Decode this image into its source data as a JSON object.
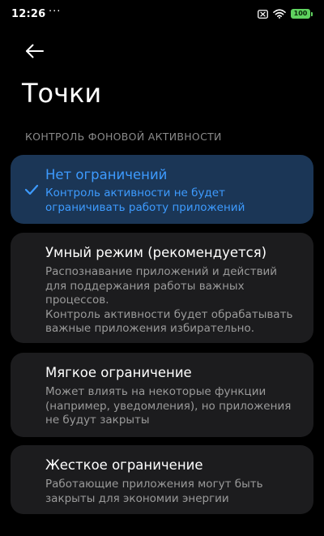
{
  "status_bar": {
    "time": "12:26",
    "more": "···",
    "battery": "100",
    "icons": [
      "no-sim-icon",
      "wifi-icon",
      "battery-icon"
    ],
    "battery_color": "#5fd35f"
  },
  "header": {
    "back_icon": "arrow-left-icon",
    "title": "Точки"
  },
  "section": {
    "label": "КОНТРОЛЬ ФОНОВОЙ АКТИВНОСТИ"
  },
  "options": [
    {
      "title": "Нет ограничений",
      "desc": [
        "Контроль активности не будет",
        "ограничивать работу приложений"
      ],
      "selected": true
    },
    {
      "title": "Умный режим (рекомендуется)",
      "desc": [
        "Распознавание приложений и действий",
        "для поддержания работы важных",
        "процессов.",
        "Контроль активности будет обрабатывать",
        "важные приложения избирательно."
      ],
      "selected": false
    },
    {
      "title": "Мягкое ограничение",
      "desc": [
        "Может влиять на некоторые функции",
        "(например, уведомления), но приложения",
        "не будут закрыты"
      ],
      "selected": false
    },
    {
      "title": "Жесткое ограничение",
      "desc": [
        "Работающие приложения могут быть",
        "закрыты для экономии энергии"
      ],
      "selected": false
    }
  ],
  "colors": {
    "background": "#000000",
    "card": "#1c1c1e",
    "selected_card": "#1b3656",
    "accent": "#3d9bff",
    "secondary_text": "#9a9a9a"
  }
}
